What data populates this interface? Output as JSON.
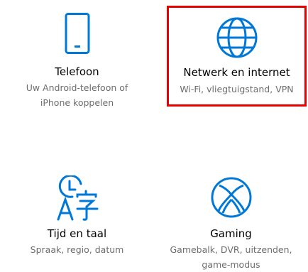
{
  "accent_color": "#0078d7",
  "highlight_color": "#e60000",
  "tiles": {
    "phone": {
      "icon": "phone-icon",
      "title": "Telefoon",
      "desc_line1": "Uw Android-telefoon of",
      "desc_line2": "iPhone koppelen"
    },
    "network": {
      "icon": "globe-icon",
      "title": "Netwerk en internet",
      "desc_line1": "Wi-Fi, vliegtuigstand, VPN",
      "highlighted": true
    },
    "time": {
      "icon": "time-language-icon",
      "title": "Tijd en taal",
      "desc_line1": "Spraak, regio, datum"
    },
    "gaming": {
      "icon": "xbox-icon",
      "title": "Gaming",
      "desc_line1": "Gamebalk, DVR, uitzenden,",
      "desc_line2": "game-modus"
    }
  }
}
